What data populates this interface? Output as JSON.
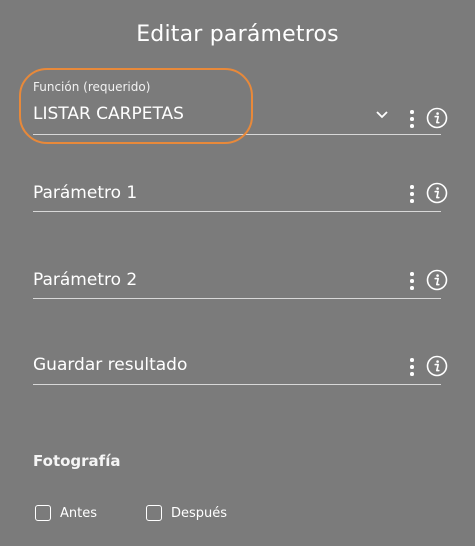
{
  "dialog": {
    "title": "Editar parámetros"
  },
  "fields": {
    "funcion": {
      "label": "Función (requerido)",
      "value": "LISTAR CARPETAS",
      "menu_icon": "kebab-menu-icon",
      "info_icon": "info-icon",
      "dropdown_icon": "chevron-down-icon"
    },
    "parametro1": {
      "placeholder": "Parámetro 1",
      "menu_icon": "kebab-menu-icon",
      "info_icon": "info-icon"
    },
    "parametro2": {
      "placeholder": "Parámetro 2",
      "menu_icon": "kebab-menu-icon",
      "info_icon": "info-icon"
    },
    "guardar": {
      "placeholder": "Guardar resultado",
      "menu_icon": "kebab-menu-icon",
      "info_icon": "info-icon"
    }
  },
  "photo": {
    "title": "Fotografía",
    "options": [
      {
        "label": "Antes",
        "checked": false
      },
      {
        "label": "Después",
        "checked": false
      }
    ]
  },
  "colors": {
    "background": "#7b7b7b",
    "highlight": "#e8893a",
    "text": "#ffffff"
  }
}
